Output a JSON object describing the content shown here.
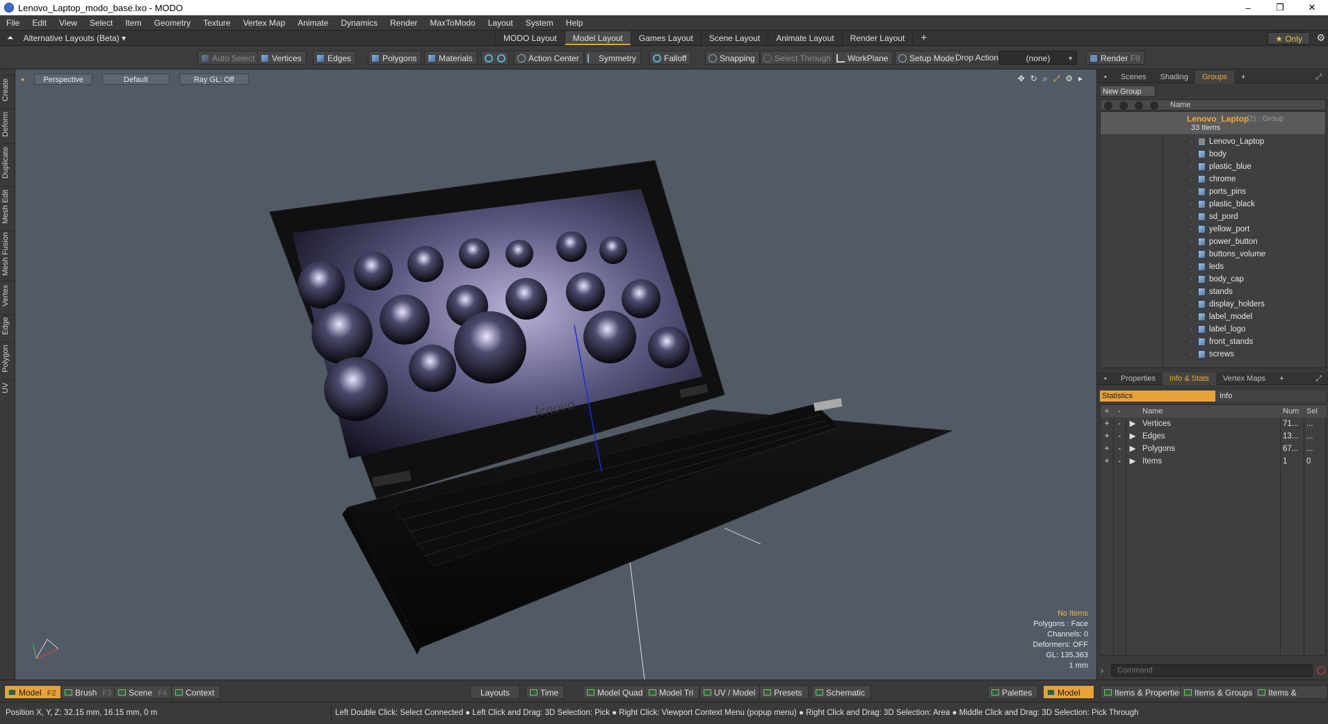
{
  "window": {
    "title": "Lenovo_Laptop_modo_base.lxo - MODO",
    "controls": {
      "minimize": "–",
      "restore": "❐",
      "close": "✕"
    }
  },
  "menubar": [
    "File",
    "Edit",
    "View",
    "Select",
    "Item",
    "Geometry",
    "Texture",
    "Vertex Map",
    "Animate",
    "Dynamics",
    "Render",
    "MaxToModo",
    "Layout",
    "System",
    "Help"
  ],
  "layoutbar": {
    "alternative": "Alternative Layouts (Beta)",
    "tabs": [
      "MODO Layout",
      "Model Layout",
      "Games Layout",
      "Scene Layout",
      "Animate Layout",
      "Render Layout"
    ],
    "active_tab": "Model Layout",
    "add": "+",
    "only": "Only"
  },
  "toolbar": {
    "auto_select": "Auto Select",
    "vertices": "Vertices",
    "edges": "Edges",
    "polygons": "Polygons",
    "materials": "Materials",
    "action_center": "Action Center",
    "symmetry": "Symmetry",
    "falloff": "Falloff",
    "snapping": "Snapping",
    "select_through": "Select Through",
    "workplane": "WorkPlane",
    "setup_mode": "Setup Mode",
    "drop_action_label": "Drop Action",
    "drop_action_value": "(none)",
    "render": "Render",
    "render_key": "F9"
  },
  "left_tabs": [
    "Create",
    "Deform",
    "Duplicate",
    "Mesh Edit",
    "Mesh Fusion",
    "Vertex",
    "Edge",
    "Polygon",
    "UV"
  ],
  "viewport": {
    "view": "Perspective",
    "shading": "Default",
    "raygl": "Ray GL: Off",
    "info": {
      "no_items": "No Items",
      "polygons": "Polygons : Face",
      "channels": "Channels: 0",
      "deformers": "Deformers: OFF",
      "gl": "GL: 135,363",
      "scale": "1 mm"
    },
    "logo_text": "lenovo"
  },
  "right_panel": {
    "top_tabs": [
      "Scenes",
      "Shading",
      "Groups"
    ],
    "top_active": "Groups",
    "new_group": "New Group",
    "tree_header": "Name",
    "group": {
      "name": "Lenovo_Laptop",
      "sub": "(2) : Group",
      "count": "33 Items"
    },
    "items": [
      "Lenovo_Laptop",
      "body",
      "plastic_blue",
      "chrome",
      "ports_pins",
      "plastic_black",
      "sd_pord",
      "yellow_port",
      "power_button",
      "buttons_volume",
      "leds",
      "body_cap",
      "stands",
      "display_holders",
      "label_model",
      "label_logo",
      "front_stands",
      "screws"
    ],
    "bottom_tabs": [
      "Properties",
      "Info & Stats",
      "Vertex Maps"
    ],
    "bottom_active": "Info & Stats",
    "stats_tab": "Statistics",
    "info_tab": "Info",
    "stats_headers": {
      "plus": "+",
      "minus": "-",
      "name": "Name",
      "num": "Num",
      "sel": "Sel"
    },
    "stats_rows": [
      {
        "name": "Vertices",
        "num": "71...",
        "sel": "..."
      },
      {
        "name": "Edges",
        "num": "13...",
        "sel": "..."
      },
      {
        "name": "Polygons",
        "num": "67...",
        "sel": "..."
      },
      {
        "name": "Items",
        "num": "1",
        "sel": "0"
      }
    ],
    "command_placeholder": "Command"
  },
  "bottombar": {
    "left": [
      {
        "label": "Model",
        "key": "F2"
      },
      {
        "label": "Brush",
        "key": "F3"
      },
      {
        "label": "Scene",
        "key": "F4"
      },
      {
        "label": "Context",
        "key": ""
      }
    ],
    "center": [
      "Layouts",
      "Time",
      "Model Quad",
      "Model Tri",
      "UV / Model",
      "Presets",
      "Schematic"
    ],
    "right": [
      "Palettes",
      "Model",
      "Items & Properties",
      "Items & Groups",
      "Items & Shading"
    ]
  },
  "statusbar": {
    "position": "Position X, Y, Z:   32.15 mm, 16.15 mm, 0 m",
    "hint": "Left Double Click: Select Connected ● Left Click and Drag: 3D Selection: Pick ● Right Click: Viewport Context Menu (popup menu) ● Right Click and Drag: 3D Selection: Area ● Middle Click and Drag: 3D Selection: Pick Through"
  }
}
